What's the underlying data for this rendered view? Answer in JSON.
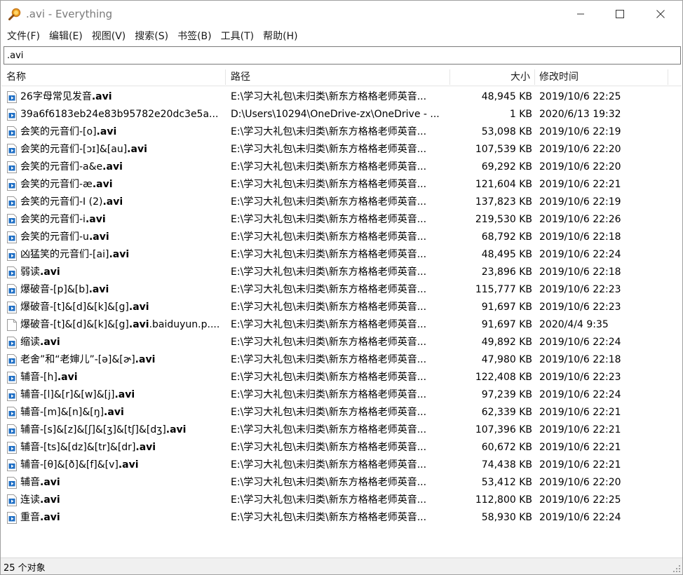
{
  "window": {
    "title": ".avi - Everything"
  },
  "menu": [
    "文件(F)",
    "编辑(E)",
    "视图(V)",
    "搜索(S)",
    "书签(B)",
    "工具(T)",
    "帮助(H)"
  ],
  "search": {
    "value": ".avi"
  },
  "columns": {
    "name": "名称",
    "path": "路径",
    "size": "大小",
    "modified": "修改时间"
  },
  "rows": [
    {
      "pre": "26字母常见发音",
      "hl": ".avi",
      "post": "",
      "path": "E:\\学习大礼包\\未归类\\新东方格格老师英音...",
      "size": "48,945 KB",
      "date": "2019/10/6 22:25",
      "icon": "video-file-icon"
    },
    {
      "pre": "39a6f6183eb24e83b95782e20dc3e5a...",
      "hl": "",
      "post": "",
      "path": "D:\\Users\\10294\\OneDrive-zx\\OneDrive - ...",
      "size": "1 KB",
      "date": "2020/6/13 19:32",
      "icon": "video-file-icon"
    },
    {
      "pre": "会笑的元音们-[o]",
      "hl": ".avi",
      "post": "",
      "path": "E:\\学习大礼包\\未归类\\新东方格格老师英音...",
      "size": "53,098 KB",
      "date": "2019/10/6 22:19",
      "icon": "video-file-icon"
    },
    {
      "pre": "会笑的元音们-[ɔɪ]&[au]",
      "hl": ".avi",
      "post": "",
      "path": "E:\\学习大礼包\\未归类\\新东方格格老师英音...",
      "size": "107,539 KB",
      "date": "2019/10/6 22:20",
      "icon": "video-file-icon"
    },
    {
      "pre": "会笑的元音们-a&e",
      "hl": ".avi",
      "post": "",
      "path": "E:\\学习大礼包\\未归类\\新东方格格老师英音...",
      "size": "69,292 KB",
      "date": "2019/10/6 22:20",
      "icon": "video-file-icon"
    },
    {
      "pre": "会笑的元音们-æ",
      "hl": ".avi",
      "post": "",
      "path": "E:\\学习大礼包\\未归类\\新东方格格老师英音...",
      "size": "121,604 KB",
      "date": "2019/10/6 22:21",
      "icon": "video-file-icon"
    },
    {
      "pre": "会笑的元音们-I (2)",
      "hl": ".avi",
      "post": "",
      "path": "E:\\学习大礼包\\未归类\\新东方格格老师英音...",
      "size": "137,823 KB",
      "date": "2019/10/6 22:19",
      "icon": "video-file-icon"
    },
    {
      "pre": "会笑的元音们-i",
      "hl": ".avi",
      "post": "",
      "path": "E:\\学习大礼包\\未归类\\新东方格格老师英音...",
      "size": "219,530 KB",
      "date": "2019/10/6 22:26",
      "icon": "video-file-icon"
    },
    {
      "pre": "会笑的元音们-u",
      "hl": ".avi",
      "post": "",
      "path": "E:\\学习大礼包\\未归类\\新东方格格老师英音...",
      "size": "68,792 KB",
      "date": "2019/10/6 22:18",
      "icon": "video-file-icon"
    },
    {
      "pre": "凶猛笑的元音们-[ai]",
      "hl": ".avi",
      "post": "",
      "path": "E:\\学习大礼包\\未归类\\新东方格格老师英音...",
      "size": "48,495 KB",
      "date": "2019/10/6 22:24",
      "icon": "video-file-icon"
    },
    {
      "pre": "弱读",
      "hl": ".avi",
      "post": "",
      "path": "E:\\学习大礼包\\未归类\\新东方格格老师英音...",
      "size": "23,896 KB",
      "date": "2019/10/6 22:18",
      "icon": "video-file-icon"
    },
    {
      "pre": "爆破音-[p]&[b]",
      "hl": ".avi",
      "post": "",
      "path": "E:\\学习大礼包\\未归类\\新东方格格老师英音...",
      "size": "115,777 KB",
      "date": "2019/10/6 22:23",
      "icon": "video-file-icon"
    },
    {
      "pre": "爆破音-[t]&[d]&[k]&[g]",
      "hl": ".avi",
      "post": "",
      "path": "E:\\学习大礼包\\未归类\\新东方格格老师英音...",
      "size": "91,697 KB",
      "date": "2019/10/6 22:23",
      "icon": "video-file-icon"
    },
    {
      "pre": "爆破音-[t]&[d]&[k]&[g]",
      "hl": ".avi",
      "post": ".baiduyun.p....",
      "path": "E:\\学习大礼包\\未归类\\新东方格格老师英音...",
      "size": "91,697 KB",
      "date": "2020/4/4 9:35",
      "icon": "blank-file-icon"
    },
    {
      "pre": "缩读",
      "hl": ".avi",
      "post": "",
      "path": "E:\\学习大礼包\\未归类\\新东方格格老师英音...",
      "size": "49,892 KB",
      "date": "2019/10/6 22:24",
      "icon": "video-file-icon"
    },
    {
      "pre": "老舍”和“老婶儿”-[ə]&[ɚ]",
      "hl": ".avi",
      "post": "",
      "path": "E:\\学习大礼包\\未归类\\新东方格格老师英音...",
      "size": "47,980 KB",
      "date": "2019/10/6 22:18",
      "icon": "video-file-icon"
    },
    {
      "pre": "辅音-[h]",
      "hl": ".avi",
      "post": "",
      "path": "E:\\学习大礼包\\未归类\\新东方格格老师英音...",
      "size": "122,408 KB",
      "date": "2019/10/6 22:23",
      "icon": "video-file-icon"
    },
    {
      "pre": "辅音-[l]&[r]&[w]&[j]",
      "hl": ".avi",
      "post": "",
      "path": "E:\\学习大礼包\\未归类\\新东方格格老师英音...",
      "size": "97,239 KB",
      "date": "2019/10/6 22:24",
      "icon": "video-file-icon"
    },
    {
      "pre": "辅音-[m]&[n]&[ŋ]",
      "hl": ".avi",
      "post": "",
      "path": "E:\\学习大礼包\\未归类\\新东方格格老师英音...",
      "size": "62,339 KB",
      "date": "2019/10/6 22:21",
      "icon": "video-file-icon"
    },
    {
      "pre": "辅音-[s]&[z]&[ʃ]&[ʒ]&[tʃ]&[dʒ]",
      "hl": ".avi",
      "post": "",
      "path": "E:\\学习大礼包\\未归类\\新东方格格老师英音...",
      "size": "107,396 KB",
      "date": "2019/10/6 22:21",
      "icon": "video-file-icon"
    },
    {
      "pre": "辅音-[ts]&[dz]&[tr]&[dr]",
      "hl": ".avi",
      "post": "",
      "path": "E:\\学习大礼包\\未归类\\新东方格格老师英音...",
      "size": "60,672 KB",
      "date": "2019/10/6 22:21",
      "icon": "video-file-icon"
    },
    {
      "pre": "辅音-[θ]&[ð]&[f]&[v]",
      "hl": ".avi",
      "post": "",
      "path": "E:\\学习大礼包\\未归类\\新东方格格老师英音...",
      "size": "74,438 KB",
      "date": "2019/10/6 22:21",
      "icon": "video-file-icon"
    },
    {
      "pre": "辅音",
      "hl": ".avi",
      "post": "",
      "path": "E:\\学习大礼包\\未归类\\新东方格格老师英音...",
      "size": "53,412 KB",
      "date": "2019/10/6 22:20",
      "icon": "video-file-icon"
    },
    {
      "pre": "连读",
      "hl": ".avi",
      "post": "",
      "path": "E:\\学习大礼包\\未归类\\新东方格格老师英音...",
      "size": "112,800 KB",
      "date": "2019/10/6 22:25",
      "icon": "video-file-icon"
    },
    {
      "pre": "重音",
      "hl": ".avi",
      "post": "",
      "path": "E:\\学习大礼包\\未归类\\新东方格格老师英音...",
      "size": "58,930 KB",
      "date": "2019/10/6 22:24",
      "icon": "video-file-icon"
    }
  ],
  "status": {
    "count_text": "25 个对象"
  },
  "colors": {
    "icon_blue": "#1f6fc5",
    "title_gray": "#7a7a7a",
    "status_bg": "#f0f0f0"
  }
}
